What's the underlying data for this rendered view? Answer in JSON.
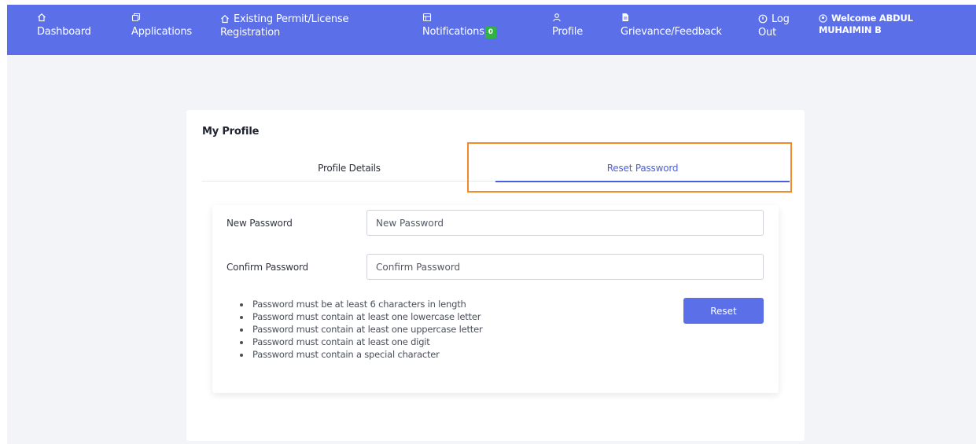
{
  "colors": {
    "navbar": "#5a6fe8",
    "accent": "#4a5fe0",
    "highlight": "#f28a2a",
    "badge": "#2fb344"
  },
  "nav": {
    "dashboard": {
      "icon": "home-icon",
      "label": "Dashboard"
    },
    "applications": {
      "icon": "copy-icon",
      "label": "Applications"
    },
    "existing_permit": {
      "icon": "home-icon",
      "line1": "Existing Permit/License",
      "line2": "Registration"
    },
    "notifications": {
      "icon": "calendar-icon",
      "label": "Notifications",
      "count": "0"
    },
    "profile": {
      "icon": "user-icon",
      "label": "Profile"
    },
    "grievance": {
      "icon": "file-icon",
      "label": "Grievance/Feedback"
    },
    "logout": {
      "icon": "power-icon",
      "line1": "Log",
      "line2": "Out"
    },
    "welcome": {
      "icon": "user-circle-icon",
      "line1": "Welcome ABDUL",
      "line2": "MUHAIMIN B"
    }
  },
  "profile": {
    "title": "My Profile",
    "tabs": {
      "details": "Profile Details",
      "reset": "Reset Password"
    },
    "active_tab": "Reset Password"
  },
  "form": {
    "new_password": {
      "label": "New Password",
      "placeholder": "New Password",
      "value": ""
    },
    "confirm_password": {
      "label": "Confirm Password",
      "placeholder": "Confirm Password",
      "value": ""
    },
    "rules": [
      "Password must be at least 6 characters in length",
      "Password must contain at least one lowercase letter",
      "Password must contain at least one uppercase letter",
      "Password must contain at least one digit",
      "Password must contain a special character"
    ],
    "reset_button": "Reset"
  }
}
